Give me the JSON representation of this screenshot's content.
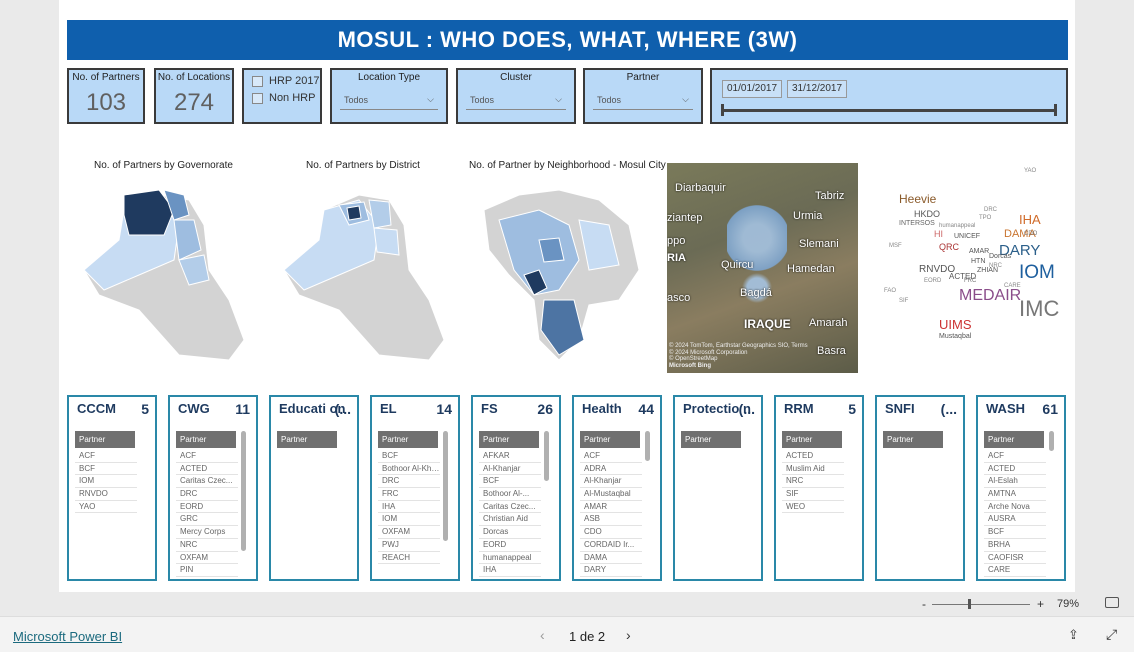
{
  "title": "MOSUL : WHO DOES, WHAT, WHERE (3W)",
  "kpis": {
    "partners_label": "No. of Partners",
    "partners_value": "103",
    "locations_label": "No. of Locations",
    "locations_value": "274"
  },
  "hrp_filter": {
    "opt1": "HRP 2017",
    "opt2": "Non HRP"
  },
  "filters": {
    "location_type": {
      "label": "Location Type",
      "value": "Todos"
    },
    "cluster": {
      "label": "Cluster",
      "value": "Todos"
    },
    "partner": {
      "label": "Partner",
      "value": "Todos"
    }
  },
  "dates": {
    "start": "01/01/2017",
    "end": "31/12/2017"
  },
  "maps": {
    "gov": "No. of Partners by Governorate",
    "district": "No. of Partners by District",
    "neighborhood": "No. of Partner by Neighborhood - Mosul City"
  },
  "bing_map": {
    "places": [
      "Diarbaquir",
      "Tabriz",
      "ziantep",
      "Urmia",
      "ppo",
      "Slemani",
      "RIA",
      "Quircu",
      "Hamedan",
      "asco",
      "Bagdá",
      "IRAQUE",
      "Amarah",
      "Basra"
    ],
    "attribution1": "© 2024 TomTom, Earthstar Geographics SIO, Terms",
    "attribution2": "© 2024 Microsoft Corporation",
    "attribution3": "© OpenStreetMap",
    "logo": "Microsoft Bing"
  },
  "word_cloud": [
    "Heevie",
    "IHA",
    "DAMA",
    "DARY",
    "IOM",
    "MEDAIR",
    "IMC",
    "UIMS",
    "RNVDO",
    "HKDO",
    "QRC",
    "HI",
    "ACTED",
    "INTERSOS",
    "humanappeal",
    "DRC",
    "NRC",
    "UNICEF",
    "FRC",
    "HTN",
    "ZHIAN",
    "CDO",
    "SIF",
    "FAO",
    "Mustaqbal",
    "AMAR",
    "Dorcas",
    "EORD",
    "TPO",
    "CARE",
    "MSF",
    "YAO"
  ],
  "clusters": [
    {
      "name": "CCCM",
      "count": "5",
      "partners": [
        "ACF",
        "BCF",
        "IOM",
        "RNVDO",
        "YAO"
      ]
    },
    {
      "name": "CWG",
      "count": "11",
      "partners": [
        "ACF",
        "ACTED",
        "Caritas Czec...",
        "DRC",
        "EORD",
        "GRC",
        "Mercy Corps",
        "NRC",
        "OXFAM",
        "PIN"
      ]
    },
    {
      "name": "Educati on",
      "count": "(...",
      "partners": []
    },
    {
      "name": "EL",
      "count": "14",
      "partners": [
        "BCF",
        "Bothoor Al-Khaer",
        "DRC",
        "FRC",
        "IHA",
        "IOM",
        "OXFAM",
        "PWJ",
        "REACH"
      ]
    },
    {
      "name": "FS",
      "count": "26",
      "partners": [
        "AFKAR",
        "Al-Khanjar",
        "BCF",
        "Bothoor Al-...",
        "Caritas Czec...",
        "Christian Aid",
        "Dorcas",
        "EORD",
        "humanappeal",
        "IHA"
      ]
    },
    {
      "name": "Health",
      "count": "44",
      "partners": [
        "ACF",
        "ADRA",
        "Al-Khanjar",
        "Al-Mustaqbal",
        "AMAR",
        "ASB",
        "CDO",
        "CORDAID Ir...",
        "DAMA",
        "DARY"
      ]
    },
    {
      "name": "Protectio n",
      "count": "(...",
      "partners": []
    },
    {
      "name": "RRM",
      "count": "5",
      "partners": [
        "ACTED",
        "Muslim Aid",
        "NRC",
        "SIF",
        "WEO"
      ]
    },
    {
      "name": "SNFI",
      "count": "(...",
      "partners": []
    },
    {
      "name": "WASH",
      "count": "61",
      "partners": [
        "ACF",
        "ACTED",
        "Al-Eslah",
        "AMTNA",
        "Arche Nova",
        "AUSRA",
        "BCF",
        "BRHA",
        "CAOFISR",
        "CARE"
      ]
    }
  ],
  "partner_header": "Partner",
  "zoom": {
    "minus": "-",
    "plus": "+",
    "level": "79%"
  },
  "footer": {
    "brand": "Microsoft Power BI",
    "page": "1 de 2"
  },
  "colors": {
    "title_bg": "#0f5fad",
    "card_bg": "#b9d9f7",
    "panel_border": "#2a88a8",
    "map_dark": "#1f3a5f",
    "map_light": "#c7dcf3",
    "map_grey": "#d3d3d3"
  }
}
